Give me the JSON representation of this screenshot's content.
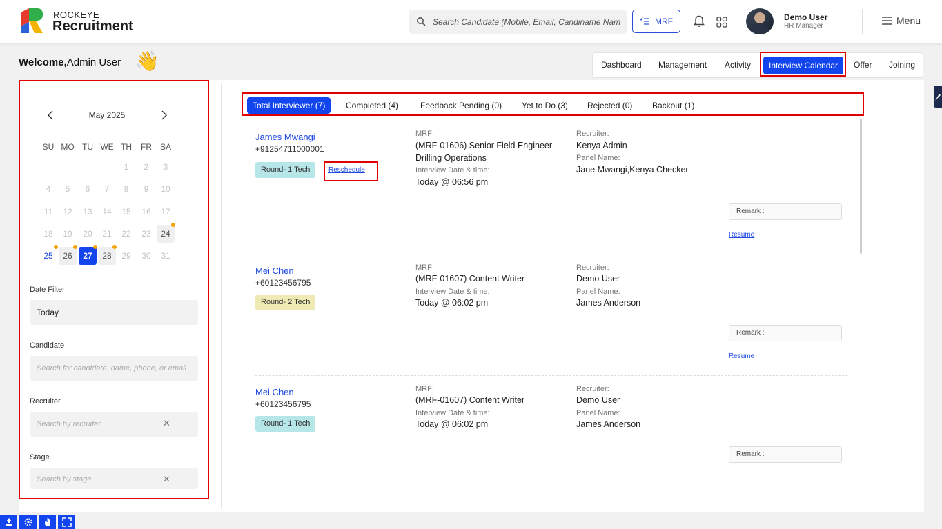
{
  "header": {
    "brand_small": "ROCKEYE",
    "brand_big": "Recruitment",
    "search_placeholder": "Search Candidate (Mobile, Email, Candiname Name)",
    "mrf_label": "MRF",
    "user_name": "Demo User",
    "user_role": "HR Manager",
    "menu_label": "Menu"
  },
  "welcome": {
    "prefix": "Welcome,",
    "name": "Admin User",
    "emoji": "👋"
  },
  "topnav": {
    "tabs": [
      {
        "label": "Dashboard"
      },
      {
        "label": "Management"
      },
      {
        "label": "Activity"
      },
      {
        "label": "Interview Calendar"
      },
      {
        "label": "Offer"
      },
      {
        "label": "Joining"
      }
    ],
    "active": "Interview Calendar"
  },
  "calendar": {
    "month_label": "May 2025",
    "weekdays": [
      "SU",
      "MO",
      "TU",
      "WE",
      "TH",
      "FR",
      "SA"
    ],
    "days": [
      "1",
      "2",
      "3",
      "4",
      "5",
      "6",
      "7",
      "8",
      "9",
      "10",
      "11",
      "12",
      "13",
      "14",
      "15",
      "16",
      "17",
      "18",
      "19",
      "20",
      "21",
      "22",
      "23",
      "24",
      "25",
      "26",
      "27",
      "28",
      "29",
      "30",
      "31"
    ],
    "selected_day": "27",
    "today_day": "25",
    "event_days": [
      "24",
      "26",
      "27",
      "28"
    ],
    "accent": "#1345ef",
    "dot_color": "#f5a300"
  },
  "filters": {
    "date_label": "Date Filter",
    "date_value": "Today",
    "candidate_label": "Candidate",
    "candidate_placeholder": "Search for candidate: name, phone, or email",
    "recruiter_label": "Recruiter",
    "recruiter_placeholder": "Search by recruiter",
    "stage_label": "Stage",
    "stage_placeholder": "Search by stage",
    "clear_symbol": "✕"
  },
  "status_tabs": [
    {
      "label": "Total Interviewer (7)"
    },
    {
      "label": "Completed (4)"
    },
    {
      "label": "Feedback Pending (0)"
    },
    {
      "label": "Yet to Do (3)"
    },
    {
      "label": "Rejected (0)"
    },
    {
      "label": "Backout (1)"
    }
  ],
  "labels": {
    "mrf": "MRF:",
    "interview_dt": "Interview Date & time:",
    "recruiter": "Recruiter:",
    "panel": "Panel Name:",
    "remark": "Remark :",
    "resume": "Resume",
    "reschedule": "Reschedule"
  },
  "interviews": [
    {
      "name": "James Mwangi",
      "phone": "+91254711000001",
      "round": "Round- 1 Tech",
      "mrf": "(MRF-01606) Senior Field Engineer – Drilling Operations",
      "datetime": "Today @ 06:56 pm",
      "recruiter": "Kenya Admin",
      "panel": "Jane Mwangi,Kenya Checker"
    },
    {
      "name": "Mei Chen",
      "phone": "+60123456795",
      "round": "Round- 2 Tech",
      "mrf": "(MRF-01607) Content Writer",
      "datetime": "Today @ 06:02 pm",
      "recruiter": "Demo User",
      "panel": "James Anderson"
    },
    {
      "name": "Mei Chen",
      "phone": "+60123456795",
      "round": "Round- 1 Tech",
      "mrf": "(MRF-01607) Content Writer",
      "datetime": "Today @ 06:02 pm",
      "recruiter": "Demo User",
      "panel": "James Anderson"
    }
  ]
}
